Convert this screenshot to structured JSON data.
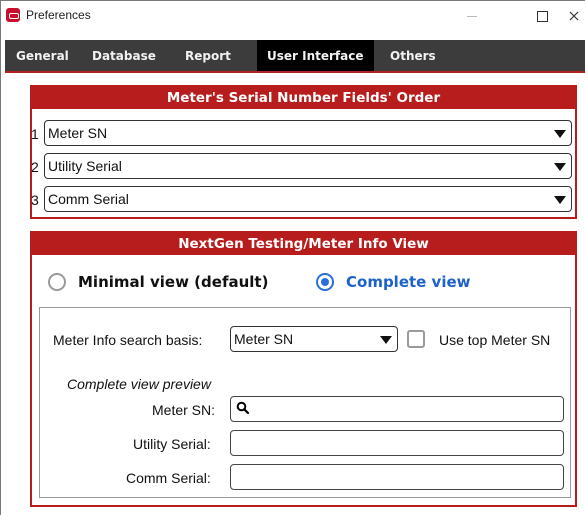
{
  "window": {
    "title": "Preferences",
    "icon": "app-logo-icon"
  },
  "tabs": [
    {
      "label": "General"
    },
    {
      "label": "Database"
    },
    {
      "label": "Report"
    },
    {
      "label": "User Interface"
    },
    {
      "label": "Others"
    }
  ],
  "active_tab": "User Interface",
  "accent_color": "#b81d1d",
  "serial_order": {
    "header": "Meter's Serial Number Fields' Order",
    "rows": [
      {
        "num": "1",
        "value": "Meter SN"
      },
      {
        "num": "2",
        "value": "Utility Serial"
      },
      {
        "num": "3",
        "value": "Comm Serial"
      }
    ]
  },
  "nextgen": {
    "header": "NextGen Testing/Meter Info View",
    "radio_minimal": {
      "label": "Minimal view (default)",
      "selected": false
    },
    "radio_complete": {
      "label": "Complete view",
      "selected": true
    },
    "search_basis_label": "Meter Info search basis:",
    "search_basis_value": "Meter SN",
    "use_top_label": "Use top Meter SN",
    "use_top_checked": false,
    "preview_title": "Complete view preview",
    "fields": {
      "meter_sn_label": "Meter SN:",
      "utility_serial_label": "Utility Serial:",
      "comm_serial_label": "Comm Serial:"
    }
  }
}
